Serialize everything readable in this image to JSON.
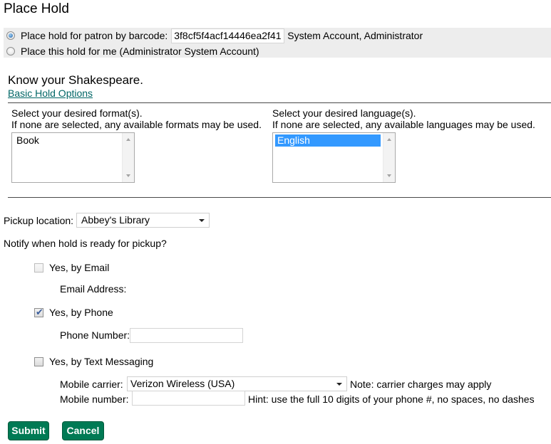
{
  "page": {
    "title": "Place Hold"
  },
  "patron": {
    "option_barcode_label": "Place hold for patron by barcode:",
    "barcode_value": "3f8cf5f4acf14446ea2f41",
    "patron_name": "System Account, Administrator",
    "option_self_label": "Place this hold for me (Administrator System Account)",
    "selected": "barcode"
  },
  "record": {
    "title": "Know your Shakespeare.",
    "basic_options_link": "Basic Hold Options"
  },
  "format": {
    "label_line1": "Select your desired format(s).",
    "label_line2": "If none are selected, any available formats may be used.",
    "options": [
      {
        "label": "Book",
        "selected": false
      }
    ]
  },
  "language": {
    "label_line1": "Select your desired language(s).",
    "label_line2": "If none are selected, any available languages may be used.",
    "options": [
      {
        "label": "English",
        "selected": true
      }
    ]
  },
  "pickup": {
    "label": "Pickup location:",
    "selected": "Abbey's Library"
  },
  "notify": {
    "question": "Notify when hold is ready for pickup?",
    "email": {
      "label": "Yes, by Email",
      "checked": false,
      "disabled": true,
      "address_label": "Email Address:",
      "address_value": ""
    },
    "phone": {
      "label": "Yes, by Phone",
      "checked": true,
      "number_label": "Phone Number:",
      "number_value": ""
    },
    "sms": {
      "label": "Yes, by Text Messaging",
      "checked": false,
      "carrier_label": "Mobile carrier:",
      "carrier_selected": "Verizon Wireless (USA)",
      "carrier_note": "Note: carrier charges may apply",
      "number_label": "Mobile number:",
      "number_value": "",
      "number_hint": "Hint: use the full 10 digits of your phone #, no spaces, no dashes"
    }
  },
  "actions": {
    "submit_label": "Submit",
    "cancel_label": "Cancel"
  },
  "colors": {
    "button_green": "#007a54",
    "link_teal": "#006666",
    "selection_blue": "#3399ff",
    "patron_box_bg": "#ededed"
  }
}
